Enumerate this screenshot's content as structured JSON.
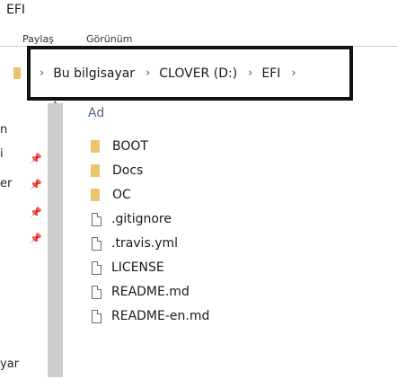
{
  "window": {
    "title": "EFI"
  },
  "ribbon": {
    "tabs": [
      "Paylaş",
      "Görünüm"
    ]
  },
  "address_bar": {
    "crumbs": [
      "Bu bilgisayar",
      "CLOVER (D:)",
      "EFI"
    ]
  },
  "nav_pane": {
    "items": [
      "n",
      "i",
      "er",
      "yar"
    ]
  },
  "file_list": {
    "column_header": "Ad",
    "items": [
      {
        "name": "BOOT",
        "type": "folder"
      },
      {
        "name": "Docs",
        "type": "folder"
      },
      {
        "name": "OC",
        "type": "folder"
      },
      {
        "name": ".gitignore",
        "type": "file"
      },
      {
        "name": ".travis.yml",
        "type": "file"
      },
      {
        "name": "LICENSE",
        "type": "file"
      },
      {
        "name": "README.md",
        "type": "file"
      },
      {
        "name": "README-en.md",
        "type": "file"
      }
    ]
  }
}
